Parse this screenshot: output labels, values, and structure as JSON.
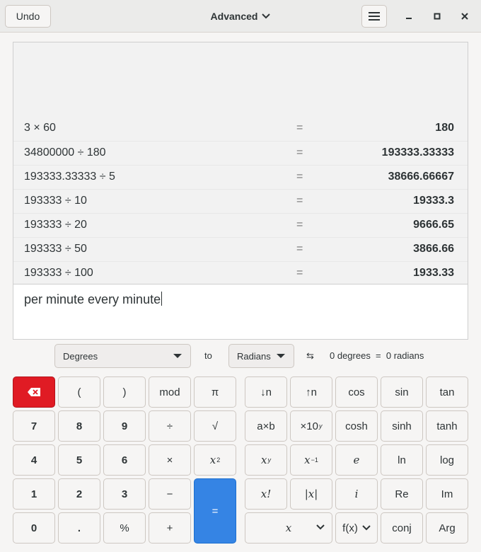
{
  "header": {
    "undo_label": "Undo",
    "mode_label": "Advanced",
    "menu_icon": "hamburger-menu-icon"
  },
  "history": [
    {
      "equation": "3 × 60",
      "sign": "=",
      "result": "180"
    },
    {
      "equation": "34800000 ÷ 180",
      "sign": "=",
      "result": "193333.33333"
    },
    {
      "equation": "193333.33333 ÷ 5",
      "sign": "=",
      "result": "38666.66667"
    },
    {
      "equation": "193333 ÷ 10",
      "sign": "=",
      "result": "19333.3"
    },
    {
      "equation": "193333 ÷ 20",
      "sign": "=",
      "result": "9666.65"
    },
    {
      "equation": "193333 ÷ 50",
      "sign": "=",
      "result": "3866.66"
    },
    {
      "equation": "193333 ÷ 100",
      "sign": "=",
      "result": "1933.33"
    }
  ],
  "entry": {
    "text": "per minute every minute"
  },
  "converter": {
    "from_unit": "Degrees",
    "to_label": "to",
    "to_unit": "Radians",
    "swap_icon": "⇆",
    "result": "0 degrees  =  0 radians"
  },
  "keys": {
    "open_paren": "(",
    "close_paren": ")",
    "mod": "mod",
    "pi": "π",
    "seven": "7",
    "eight": "8",
    "nine": "9",
    "divide": "÷",
    "sqrt": "√",
    "four": "4",
    "five": "5",
    "six": "6",
    "multiply": "×",
    "square_base": "x",
    "square_exp": "2",
    "one": "1",
    "two": "2",
    "three": "3",
    "minus": "−",
    "zero": "0",
    "point": ".",
    "percent": "%",
    "plus": "+",
    "equals": "=",
    "down_n": "↓n",
    "up_n": "↑n",
    "cos": "cos",
    "sin": "sin",
    "tan": "tan",
    "axb": "a×b",
    "sci_base": "×10",
    "sci_exp": "y",
    "cosh": "cosh",
    "sinh": "sinh",
    "tanh": "tanh",
    "pow_base": "x",
    "pow_exp": "y",
    "inv_base": "x",
    "inv_exp": "−1",
    "e": "e",
    "ln": "ln",
    "log": "log",
    "factorial": "x!",
    "abs": "|x|",
    "i": "i",
    "re": "Re",
    "im": "Im",
    "variable": "x",
    "function": "f(x)",
    "conj": "conj",
    "arg": "Arg"
  },
  "colors": {
    "delete": "#e01b24",
    "equals": "#3584e4"
  }
}
